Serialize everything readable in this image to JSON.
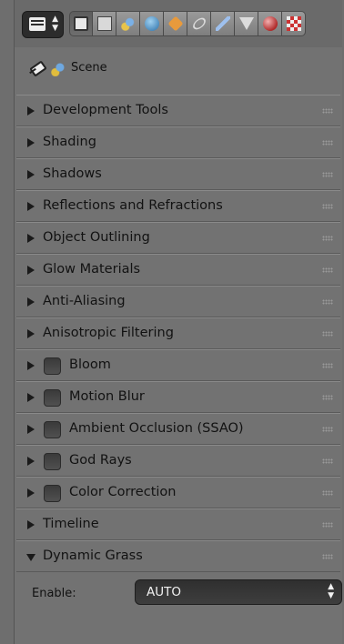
{
  "header": {
    "context_tabs": [
      {
        "icon": "render-icon",
        "active": true
      },
      {
        "icon": "render-layers-icon",
        "active": false
      },
      {
        "icon": "scene-icon",
        "active": false
      },
      {
        "icon": "world-icon",
        "active": false
      },
      {
        "icon": "object-icon",
        "active": false
      },
      {
        "icon": "constraints-icon",
        "active": false
      },
      {
        "icon": "modifiers-icon",
        "active": false
      },
      {
        "icon": "data-icon",
        "active": false
      },
      {
        "icon": "material-icon",
        "active": false
      },
      {
        "icon": "texture-icon",
        "active": false
      }
    ]
  },
  "breadcrumb": {
    "scene_label": "Scene"
  },
  "panels": [
    {
      "label": "Development Tools",
      "checkbox": false,
      "expanded": false
    },
    {
      "label": "Shading",
      "checkbox": false,
      "expanded": false
    },
    {
      "label": "Shadows",
      "checkbox": false,
      "expanded": false
    },
    {
      "label": "Reflections and Refractions",
      "checkbox": false,
      "expanded": false
    },
    {
      "label": "Object Outlining",
      "checkbox": false,
      "expanded": false
    },
    {
      "label": "Glow Materials",
      "checkbox": false,
      "expanded": false
    },
    {
      "label": "Anti-Aliasing",
      "checkbox": false,
      "expanded": false
    },
    {
      "label": "Anisotropic Filtering",
      "checkbox": false,
      "expanded": false
    },
    {
      "label": "Bloom",
      "checkbox": true,
      "expanded": false
    },
    {
      "label": "Motion Blur",
      "checkbox": true,
      "expanded": false
    },
    {
      "label": "Ambient Occlusion (SSAO)",
      "checkbox": true,
      "expanded": false
    },
    {
      "label": "God Rays",
      "checkbox": true,
      "expanded": false
    },
    {
      "label": "Color Correction",
      "checkbox": true,
      "expanded": false
    },
    {
      "label": "Timeline",
      "checkbox": false,
      "expanded": false
    },
    {
      "label": "Dynamic Grass",
      "checkbox": false,
      "expanded": true
    }
  ],
  "dynamic_grass": {
    "enable_label": "Enable:",
    "enable_value": "AUTO"
  }
}
